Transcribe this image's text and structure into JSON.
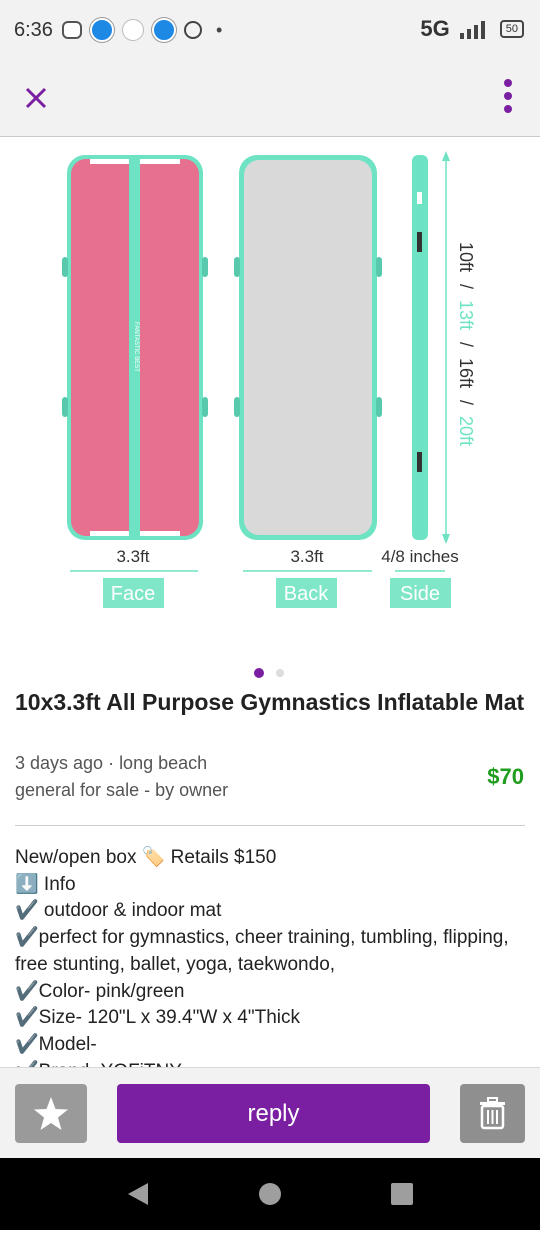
{
  "status_bar": {
    "time": "6:36",
    "network": "5G",
    "battery": "50"
  },
  "toolbar": {
    "close_icon": "close-icon",
    "more_icon": "more-vert-icon"
  },
  "image": {
    "labels": {
      "face_width": "3.3ft",
      "back_width": "3.3ft",
      "side_width": "4/8 inches",
      "face": "Face",
      "back": "Back",
      "side": "Side"
    },
    "lengths": {
      "len1": "10ft",
      "sep1": "/",
      "len2": "13ft",
      "sep2": "/",
      "len3": "16ft",
      "sep3": "/",
      "len4": "20ft"
    },
    "mat_text": "FANTASTIC BEST",
    "colors": {
      "pink": "#e8708f",
      "mint": "#6ee3c3",
      "gray": "#d9d9d9"
    }
  },
  "carousel": {
    "count": 2,
    "active": 1
  },
  "listing": {
    "title": "10x3.3ft All Purpose Gymnastics Inflatable Mat",
    "posted": "3 days ago · long beach",
    "category": "general for sale - by owner",
    "price": "$70",
    "description": [
      "New/open box 🏷️ Retails $150",
      "⬇️ Info",
      "✔️ outdoor & indoor mat",
      "✔️perfect for gymnastics, cheer training, tumbling, flipping, free stunting, ballet, yoga, taekwondo,",
      "✔️Color- pink/green",
      "✔️Size- 120\"L x 39.4\"W x 4\"Thick",
      "✔️Model-",
      "✔️Brand- YOFiTNY"
    ]
  },
  "actions": {
    "favorite_icon": "star-icon",
    "reply_label": "reply",
    "delete_icon": "trash-icon"
  },
  "nav": {
    "back_icon": "back-triangle-icon",
    "home_icon": "home-circle-icon",
    "recents_icon": "recents-square-icon"
  },
  "theme": {
    "accent": "#7b1fa2",
    "price": "#1f9d1f"
  }
}
